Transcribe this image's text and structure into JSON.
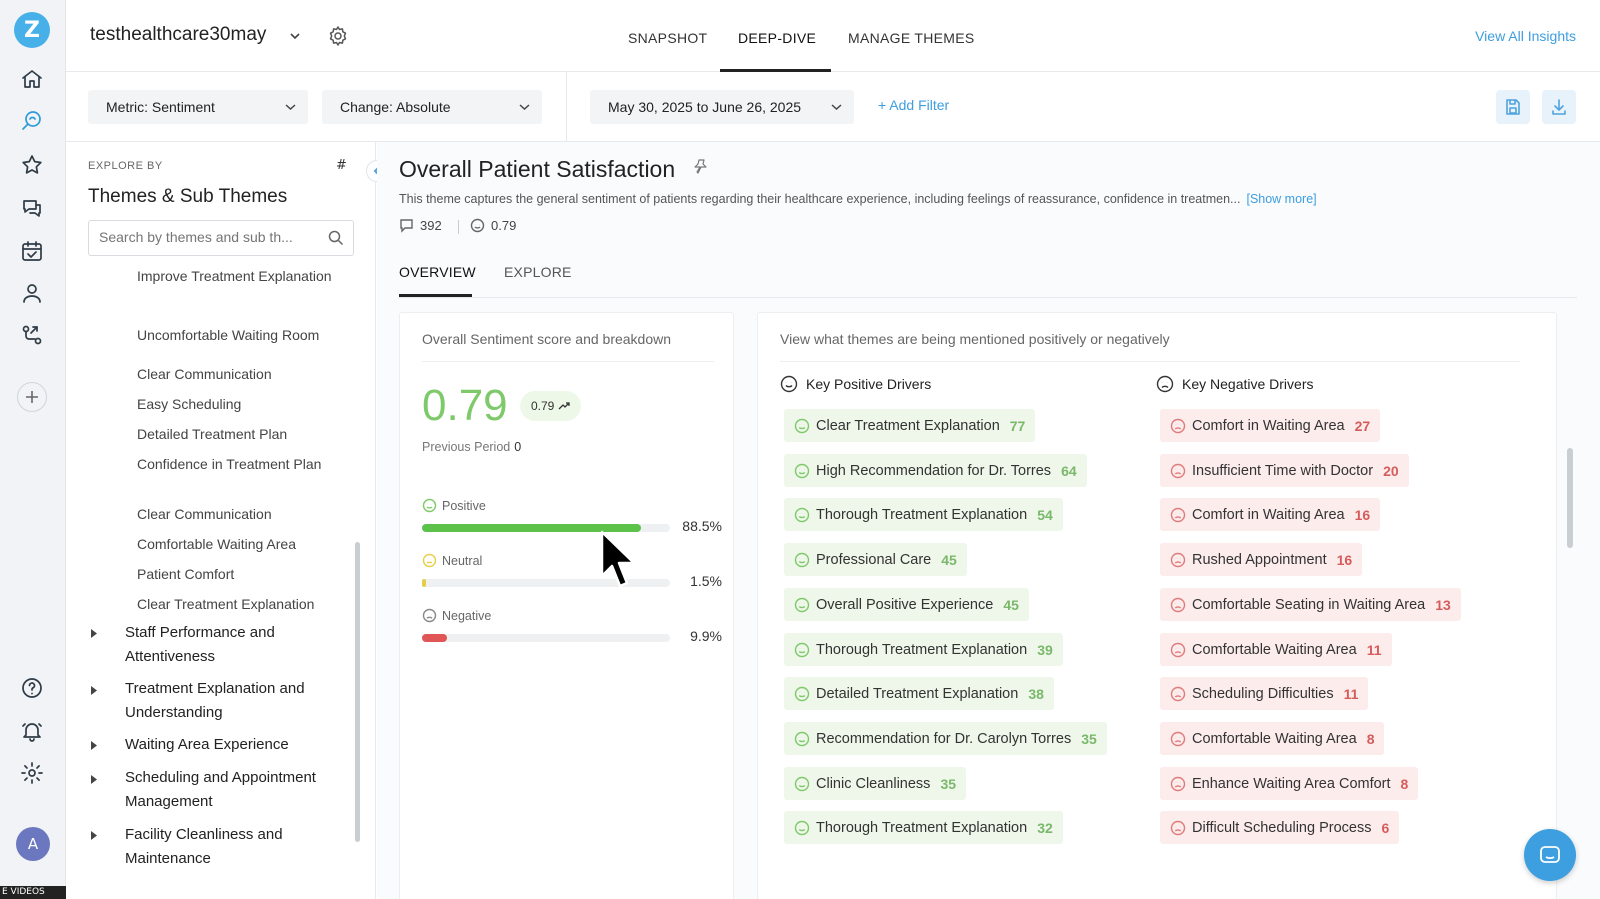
{
  "app": {
    "logo_letter": "Z",
    "avatar_initial": "A",
    "videos_tag": "E VIDEOS",
    "accent_color": "#3d9ee0",
    "positive_color": "#7ec96a",
    "negative_color": "#d65c5c"
  },
  "rail": {
    "items": [
      {
        "name": "home-icon"
      },
      {
        "name": "insights-search-icon",
        "active": true
      },
      {
        "name": "star-icon"
      },
      {
        "name": "chat-bubbles-icon"
      },
      {
        "name": "calendar-check-icon"
      },
      {
        "name": "user-icon"
      },
      {
        "name": "workflow-icon"
      }
    ],
    "bottom_items": [
      {
        "name": "help-icon"
      },
      {
        "name": "bell-icon"
      },
      {
        "name": "settings-icon"
      }
    ]
  },
  "header": {
    "workspace": "testhealthcare30may",
    "tabs": [
      {
        "label": "SNAPSHOT"
      },
      {
        "label": "DEEP-DIVE",
        "active": true
      },
      {
        "label": "MANAGE THEMES"
      }
    ],
    "view_all": "View All Insights"
  },
  "filters": {
    "metric": "Metric: Sentiment",
    "change": "Change: Absolute",
    "date_range": "May 30, 2025 to June 26, 2025",
    "add_filter": "+ Add Filter"
  },
  "explore": {
    "label": "EXPLORE BY",
    "hash": "#",
    "title": "Themes & Sub Themes",
    "search_placeholder": "Search by themes and sub th...",
    "sub_themes": [
      "Improve Treatment Explanation",
      "Uncomfortable Waiting Room",
      "Clear Communication",
      "Easy Scheduling",
      "Detailed Treatment Plan",
      "Confidence in Treatment Plan",
      "Clear Communication",
      "Comfortable Waiting Area",
      "Patient Comfort",
      "Clear Treatment Explanation"
    ],
    "parent_themes": [
      "Staff Performance and Attentiveness",
      "Treatment Explanation and Understanding",
      "Waiting Area Experience",
      "Scheduling and Appointment Management",
      "Facility Cleanliness and Maintenance"
    ]
  },
  "theme": {
    "title": "Overall Patient Satisfaction",
    "description": "This theme captures the general sentiment of patients regarding their healthcare experience, including feelings of reassurance, confidence in treatmen...",
    "show_more": "[Show more]",
    "comment_count": "392",
    "score": "0.79",
    "subtabs": [
      {
        "label": "OVERVIEW",
        "active": true
      },
      {
        "label": "EXPLORE"
      }
    ]
  },
  "sentiment_card": {
    "title": "Overall Sentiment score and breakdown",
    "score": "0.79",
    "trend_value": "0.79",
    "previous_label": "Previous Period",
    "previous_value": "0",
    "rows": [
      {
        "label": "Positive",
        "pct_text": "88.5%",
        "fraction": 0.885,
        "color": "#5cc24a"
      },
      {
        "label": "Neutral",
        "pct_text": "1.5%",
        "fraction": 0.015,
        "color": "#e5cf4a"
      },
      {
        "label": "Negative",
        "pct_text": "9.9%",
        "fraction": 0.099,
        "color": "#e05555"
      }
    ]
  },
  "drivers_card": {
    "title": "View what themes are being mentioned positively or negatively",
    "positive_title": "Key Positive Drivers",
    "negative_title": "Key Negative Drivers",
    "positive": [
      {
        "label": "Clear Treatment Explanation",
        "count": "77"
      },
      {
        "label": "High Recommendation for Dr. Torres",
        "count": "64"
      },
      {
        "label": "Thorough Treatment Explanation",
        "count": "54"
      },
      {
        "label": "Professional Care",
        "count": "45"
      },
      {
        "label": "Overall Positive Experience",
        "count": "45"
      },
      {
        "label": "Thorough Treatment Explanation",
        "count": "39"
      },
      {
        "label": "Detailed Treatment Explanation",
        "count": "38"
      },
      {
        "label": "Recommendation for Dr. Carolyn Torres",
        "count": "35"
      },
      {
        "label": "Clinic Cleanliness",
        "count": "35"
      },
      {
        "label": "Thorough Treatment Explanation",
        "count": "32"
      }
    ],
    "negative": [
      {
        "label": "Comfort in Waiting Area",
        "count": "27"
      },
      {
        "label": "Insufficient Time with Doctor",
        "count": "20"
      },
      {
        "label": "Comfort in Waiting Area",
        "count": "16"
      },
      {
        "label": "Rushed Appointment",
        "count": "16"
      },
      {
        "label": "Comfortable Seating in Waiting Area",
        "count": "13"
      },
      {
        "label": "Comfortable Waiting Area",
        "count": "11"
      },
      {
        "label": "Scheduling Difficulties",
        "count": "11"
      },
      {
        "label": "Comfortable Waiting Area",
        "count": "8"
      },
      {
        "label": "Enhance Waiting Area Comfort",
        "count": "8"
      },
      {
        "label": "Difficult Scheduling Process",
        "count": "6"
      }
    ]
  }
}
